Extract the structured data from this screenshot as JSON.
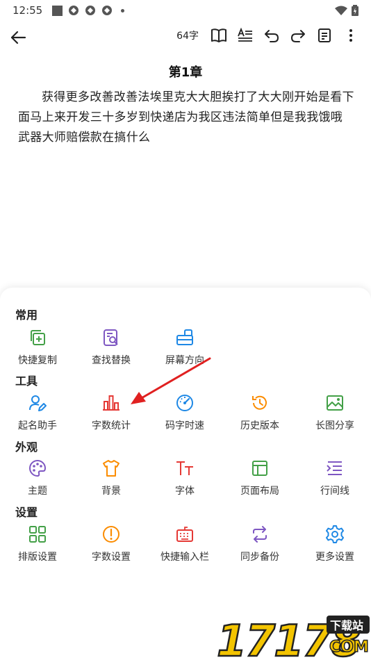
{
  "status_bar": {
    "time": "12:55"
  },
  "toolbar": {
    "word_count": "64字"
  },
  "chapter": {
    "title": "第1章",
    "body": "获得更多改善改善法埃里克大大胆挨打了大大刚开始是看下面马上来开发三十多岁到快递店为我区违法简单但是我我饿哦武器大师赔偿款在搞什么"
  },
  "panel": {
    "sections": [
      {
        "title": "常用",
        "items": [
          "快捷复制",
          "查找替换",
          "屏幕方向"
        ]
      },
      {
        "title": "工具",
        "items": [
          "起名助手",
          "字数统计",
          "码字时速",
          "历史版本",
          "长图分享"
        ]
      },
      {
        "title": "外观",
        "items": [
          "主题",
          "背景",
          "字体",
          "页面布局",
          "行间线"
        ]
      },
      {
        "title": "设置",
        "items": [
          "排版设置",
          "字数设置",
          "快捷输入栏",
          "同步备份",
          "更多设置"
        ]
      }
    ]
  },
  "watermark": {
    "number": "17178",
    "tag": "下载站",
    "suffix": "COM"
  },
  "colors": {
    "green": "#43a047",
    "purple": "#7e57c2",
    "blue": "#1e88e5",
    "red": "#e53935",
    "orange": "#fb8c00",
    "arrow": "#e02020"
  }
}
